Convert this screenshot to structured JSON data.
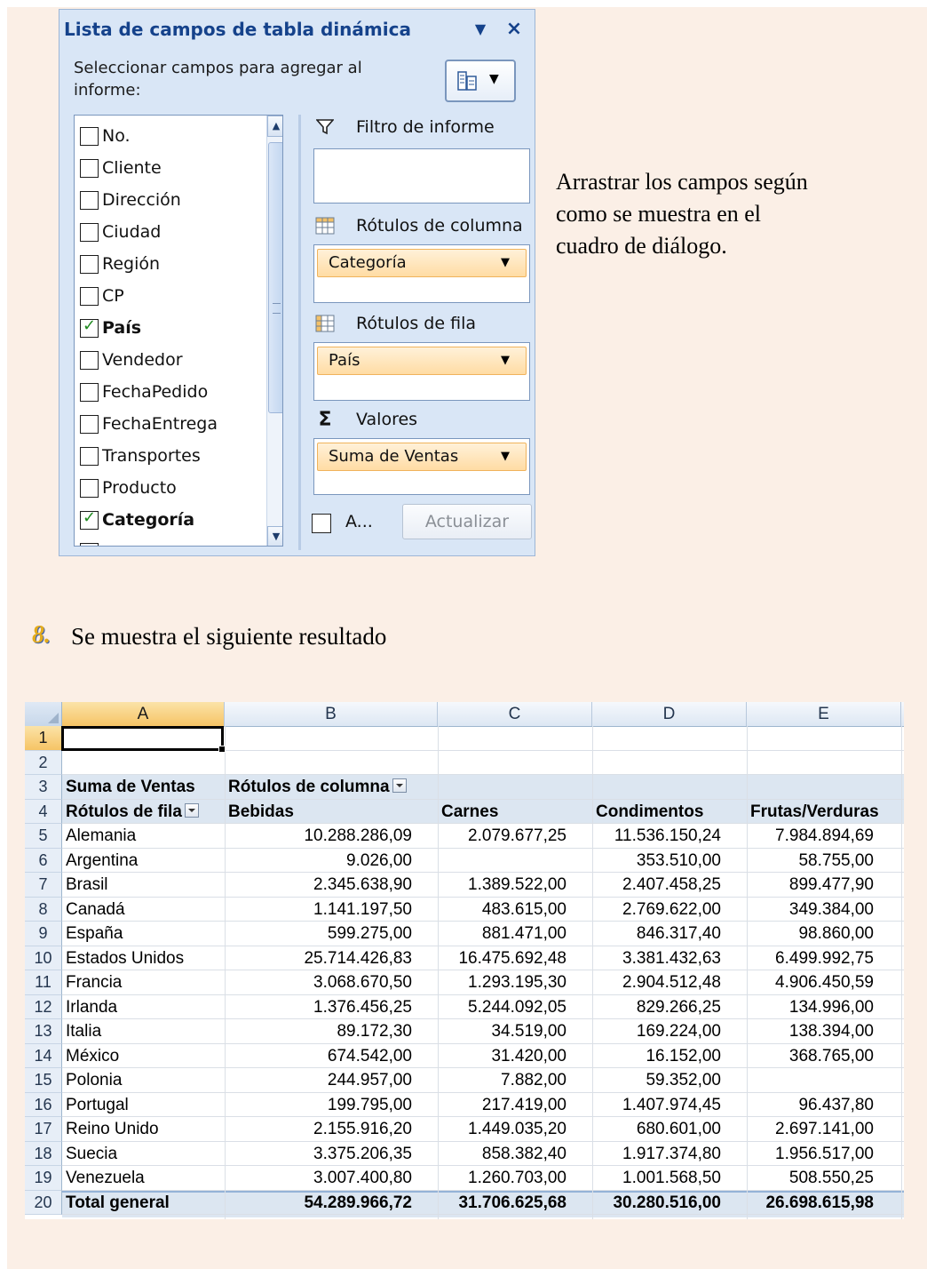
{
  "panel": {
    "title": "Lista de campos de tabla dinámica",
    "select_label": "Seleccionar campos para agregar al informe:",
    "fields": [
      {
        "label": "No.",
        "checked": false
      },
      {
        "label": "Cliente",
        "checked": false
      },
      {
        "label": "Dirección",
        "checked": false
      },
      {
        "label": "Ciudad",
        "checked": false
      },
      {
        "label": "Región",
        "checked": false
      },
      {
        "label": "CP",
        "checked": false
      },
      {
        "label": "País",
        "checked": true
      },
      {
        "label": "Vendedor",
        "checked": false
      },
      {
        "label": "FechaPedido",
        "checked": false
      },
      {
        "label": "FechaEntrega",
        "checked": false
      },
      {
        "label": "Transportes",
        "checked": false
      },
      {
        "label": "Producto",
        "checked": false
      },
      {
        "label": "Categoría",
        "checked": true
      }
    ],
    "areas": {
      "report_filter": "Filtro de informe",
      "column_labels": "Rótulos de columna",
      "column_field": "Categoría",
      "row_labels": "Rótulos de fila",
      "row_field": "País",
      "values": "Valores",
      "values_field": "Suma de Ventas"
    },
    "defer_label": "A...",
    "update_button": "Actualizar"
  },
  "instruction": "Arrastrar los campos según como se muestra en el cuadro de diálogo.",
  "step": {
    "number": "8.",
    "text": "Se muestra el siguiente resultado"
  },
  "sheet": {
    "columns": [
      "A",
      "B",
      "C",
      "D",
      "E"
    ],
    "row_numbers": [
      "1",
      "2",
      "3",
      "4",
      "5",
      "6",
      "7",
      "8",
      "9",
      "10",
      "11",
      "12",
      "13",
      "14",
      "15",
      "16",
      "17",
      "18",
      "19",
      "20"
    ],
    "values_header": "Suma de Ventas",
    "column_labels_header": "Rótulos de columna",
    "row_labels_header": "Rótulos de fila",
    "categories": [
      "Bebidas",
      "Carnes",
      "Condimentos",
      "Frutas/Verduras"
    ],
    "rows": [
      {
        "country": "Alemania",
        "values": [
          "10.288.286,09",
          "2.079.677,25",
          "11.536.150,24",
          "7.984.894,69"
        ]
      },
      {
        "country": "Argentina",
        "values": [
          "9.026,00",
          "",
          "353.510,00",
          "58.755,00"
        ]
      },
      {
        "country": "Brasil",
        "values": [
          "2.345.638,90",
          "1.389.522,00",
          "2.407.458,25",
          "899.477,90"
        ]
      },
      {
        "country": "Canadá",
        "values": [
          "1.141.197,50",
          "483.615,00",
          "2.769.622,00",
          "349.384,00"
        ]
      },
      {
        "country": "España",
        "values": [
          "599.275,00",
          "881.471,00",
          "846.317,40",
          "98.860,00"
        ]
      },
      {
        "country": "Estados Unidos",
        "values": [
          "25.714.426,83",
          "16.475.692,48",
          "3.381.432,63",
          "6.499.992,75"
        ]
      },
      {
        "country": "Francia",
        "values": [
          "3.068.670,50",
          "1.293.195,30",
          "2.904.512,48",
          "4.906.450,59"
        ]
      },
      {
        "country": "Irlanda",
        "values": [
          "1.376.456,25",
          "5.244.092,05",
          "829.266,25",
          "134.996,00"
        ]
      },
      {
        "country": "Italia",
        "values": [
          "89.172,30",
          "34.519,00",
          "169.224,00",
          "138.394,00"
        ]
      },
      {
        "country": "México",
        "values": [
          "674.542,00",
          "31.420,00",
          "16.152,00",
          "368.765,00"
        ]
      },
      {
        "country": "Polonia",
        "values": [
          "244.957,00",
          "7.882,00",
          "59.352,00",
          ""
        ]
      },
      {
        "country": "Portugal",
        "values": [
          "199.795,00",
          "217.419,00",
          "1.407.974,45",
          "96.437,80"
        ]
      },
      {
        "country": "Reino Unido",
        "values": [
          "2.155.916,20",
          "1.449.035,20",
          "680.601,00",
          "2.697.141,00"
        ]
      },
      {
        "country": "Suecia",
        "values": [
          "3.375.206,35",
          "858.382,40",
          "1.917.374,80",
          "1.956.517,00"
        ]
      },
      {
        "country": "Venezuela",
        "values": [
          "3.007.400,80",
          "1.260.703,00",
          "1.001.568,50",
          "508.550,25"
        ]
      }
    ],
    "total_label": "Total general",
    "totals": [
      "54.289.966,72",
      "31.706.625,68",
      "30.280.516,00",
      "26.698.615,98"
    ]
  }
}
